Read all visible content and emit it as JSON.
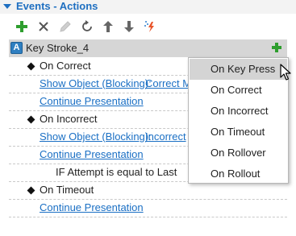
{
  "panel": {
    "title": "Events - Actions"
  },
  "toolbar": {
    "add_icon": "plus-icon",
    "delete_icon": "x-icon",
    "edit_icon": "pencil-icon",
    "reset_icon": "refresh-icon",
    "move_up_icon": "arrow-up-icon",
    "move_down_icon": "arrow-down-icon",
    "magic_icon": "magic-wand-icon"
  },
  "trigger": {
    "icon_letter": "A",
    "label": "Key Stroke_4"
  },
  "events": [
    {
      "label": "On Correct",
      "actions": [
        {
          "action": "Show Object (Blocking):",
          "target": "Correct M"
        },
        {
          "action": "Continue Presentation"
        }
      ]
    },
    {
      "label": "On Incorrect",
      "actions": [
        {
          "action": "Show Object (Blocking):",
          "target": "Incorrect"
        },
        {
          "action": "Continue Presentation"
        }
      ],
      "condition": "IF Attempt is equal to Last"
    },
    {
      "label": "On Timeout",
      "actions": [
        {
          "action": "Continue Presentation"
        }
      ]
    }
  ],
  "menu": {
    "items": [
      "On Key Press",
      "On Correct",
      "On Incorrect",
      "On Timeout",
      "On Rollover",
      "On Rollout"
    ],
    "selected": "On Key Press"
  },
  "colors": {
    "accent": "#1e6fc1",
    "link": "#1a6fc4",
    "add_green": "#2e9e2e",
    "selection": "#d4d4d4"
  }
}
